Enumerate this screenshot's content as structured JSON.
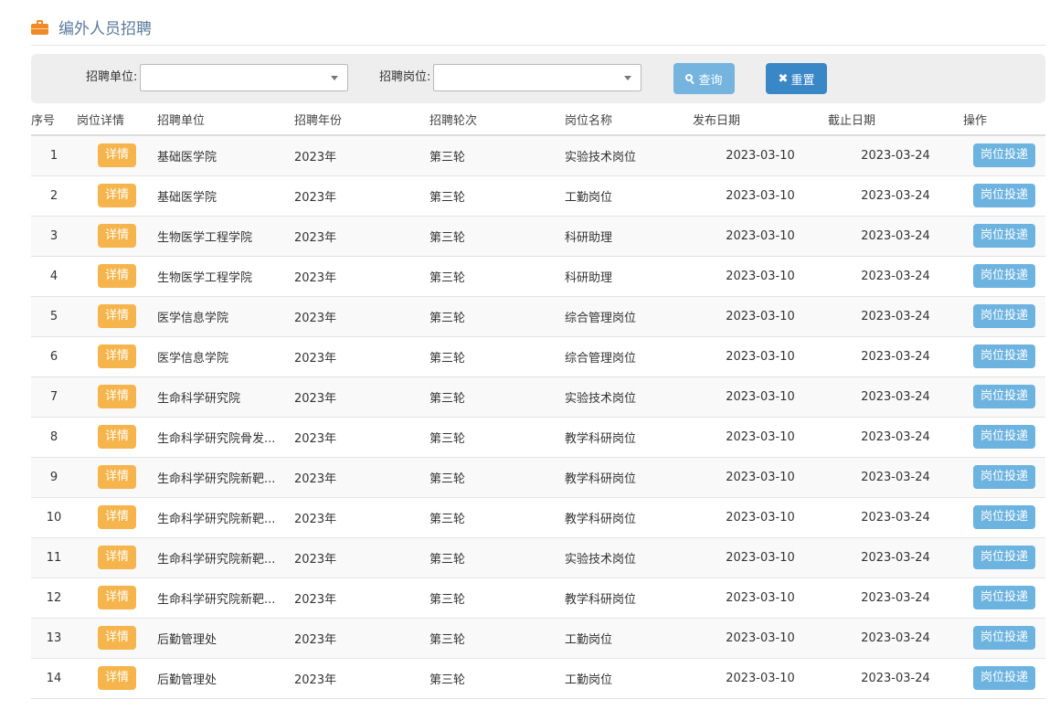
{
  "header": {
    "title": "编外人员招聘",
    "icon": "briefcase-icon"
  },
  "filters": {
    "unit_label": "招聘单位:",
    "unit_value": "",
    "position_label": "招聘岗位:",
    "position_value": "",
    "query_label": "查询",
    "reset_label": "重置"
  },
  "colors": {
    "accent_orange": "#f5b54c",
    "accent_blue": "#6db3e0",
    "reset_blue": "#3a87c8",
    "title_blue": "#5b7a9e"
  },
  "table": {
    "columns": [
      "序号",
      "岗位详情",
      "招聘单位",
      "招聘年份",
      "招聘轮次",
      "岗位名称",
      "发布日期",
      "截止日期",
      "操作"
    ],
    "detail_label": "详情",
    "apply_label": "岗位投递",
    "rows": [
      {
        "no": "1",
        "unit": "基础医学院",
        "year": "2023年",
        "round": "第三轮",
        "post": "实验技术岗位",
        "publish": "2023-03-10",
        "deadline": "2023-03-24"
      },
      {
        "no": "2",
        "unit": "基础医学院",
        "year": "2023年",
        "round": "第三轮",
        "post": "工勤岗位",
        "publish": "2023-03-10",
        "deadline": "2023-03-24"
      },
      {
        "no": "3",
        "unit": "生物医学工程学院",
        "year": "2023年",
        "round": "第三轮",
        "post": "科研助理",
        "publish": "2023-03-10",
        "deadline": "2023-03-24"
      },
      {
        "no": "4",
        "unit": "生物医学工程学院",
        "year": "2023年",
        "round": "第三轮",
        "post": "科研助理",
        "publish": "2023-03-10",
        "deadline": "2023-03-24"
      },
      {
        "no": "5",
        "unit": "医学信息学院",
        "year": "2023年",
        "round": "第三轮",
        "post": "综合管理岗位",
        "publish": "2023-03-10",
        "deadline": "2023-03-24"
      },
      {
        "no": "6",
        "unit": "医学信息学院",
        "year": "2023年",
        "round": "第三轮",
        "post": "综合管理岗位",
        "publish": "2023-03-10",
        "deadline": "2023-03-24"
      },
      {
        "no": "7",
        "unit": "生命科学研究院",
        "year": "2023年",
        "round": "第三轮",
        "post": "实验技术岗位",
        "publish": "2023-03-10",
        "deadline": "2023-03-24"
      },
      {
        "no": "8",
        "unit": "生命科学研究院骨发...",
        "year": "2023年",
        "round": "第三轮",
        "post": "教学科研岗位",
        "publish": "2023-03-10",
        "deadline": "2023-03-24"
      },
      {
        "no": "9",
        "unit": "生命科学研究院新靶...",
        "year": "2023年",
        "round": "第三轮",
        "post": "教学科研岗位",
        "publish": "2023-03-10",
        "deadline": "2023-03-24"
      },
      {
        "no": "10",
        "unit": "生命科学研究院新靶...",
        "year": "2023年",
        "round": "第三轮",
        "post": "教学科研岗位",
        "publish": "2023-03-10",
        "deadline": "2023-03-24"
      },
      {
        "no": "11",
        "unit": "生命科学研究院新靶...",
        "year": "2023年",
        "round": "第三轮",
        "post": "实验技术岗位",
        "publish": "2023-03-10",
        "deadline": "2023-03-24"
      },
      {
        "no": "12",
        "unit": "生命科学研究院新靶...",
        "year": "2023年",
        "round": "第三轮",
        "post": "教学科研岗位",
        "publish": "2023-03-10",
        "deadline": "2023-03-24"
      },
      {
        "no": "13",
        "unit": "后勤管理处",
        "year": "2023年",
        "round": "第三轮",
        "post": "工勤岗位",
        "publish": "2023-03-10",
        "deadline": "2023-03-24"
      },
      {
        "no": "14",
        "unit": "后勤管理处",
        "year": "2023年",
        "round": "第三轮",
        "post": "工勤岗位",
        "publish": "2023-03-10",
        "deadline": "2023-03-24"
      }
    ]
  }
}
